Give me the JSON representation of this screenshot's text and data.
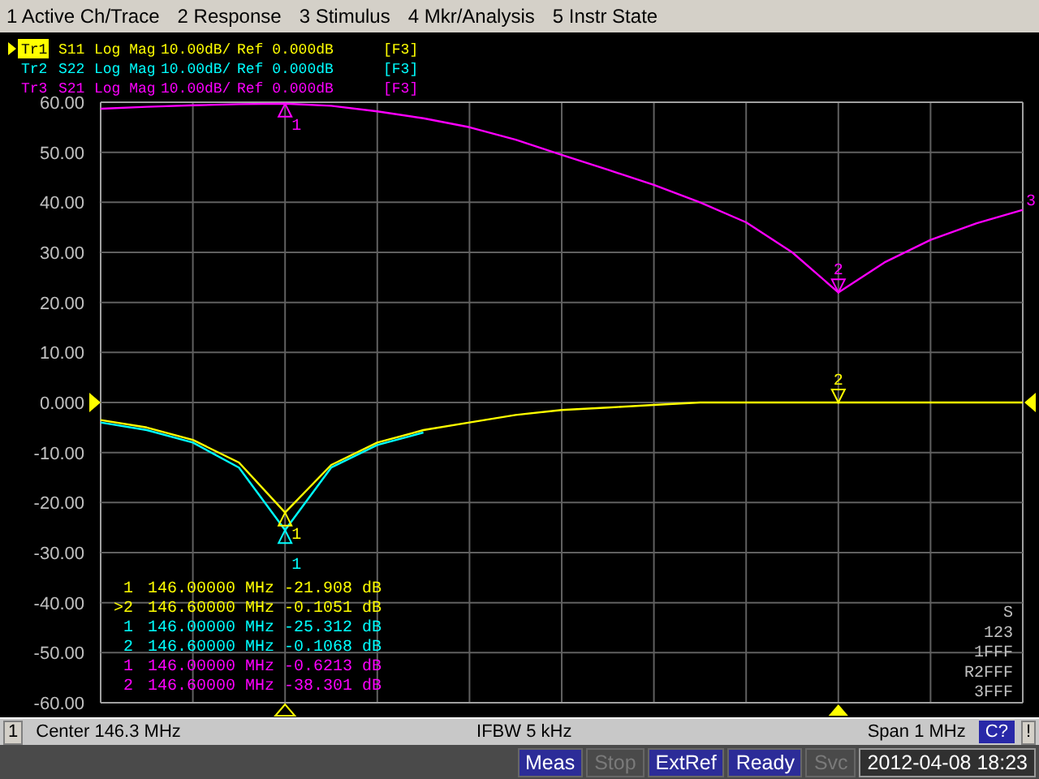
{
  "menu": [
    "1 Active Ch/Trace",
    "2 Response",
    "3 Stimulus",
    "4 Mkr/Analysis",
    "5 Instr State"
  ],
  "traces": [
    {
      "name": "Tr1",
      "parameter": "S11",
      "format": "Log Mag",
      "scale": "10.00dB/",
      "reference": "Ref 0.000dB",
      "tag": "[F3]",
      "selected": true,
      "markers": [
        "1",
        "2"
      ]
    },
    {
      "name": "Tr2",
      "parameter": "S22",
      "format": "Log Mag",
      "scale": "10.00dB/",
      "reference": "Ref 0.000dB",
      "tag": "[F3]",
      "selected": false,
      "markers": [
        "1"
      ]
    },
    {
      "name": "Tr3",
      "parameter": "S21",
      "format": "Log Mag",
      "scale": "10.00dB/",
      "reference": "Ref 0.000dB",
      "tag": "[F3]",
      "selected": false,
      "markers": [
        "1",
        "2"
      ],
      "end_label": "3"
    }
  ],
  "chart_data": {
    "type": "line",
    "grid": true,
    "ylim": [
      -60,
      60
    ],
    "yticks": [
      {
        "value": 60,
        "label": "60.00"
      },
      {
        "value": 50,
        "label": "50.00"
      },
      {
        "value": 40,
        "label": "40.00"
      },
      {
        "value": 30,
        "label": "30.00"
      },
      {
        "value": 20,
        "label": "20.00"
      },
      {
        "value": 10,
        "label": "10.00"
      },
      {
        "value": 0,
        "label": "0.000"
      },
      {
        "value": -10,
        "label": "-10.00"
      },
      {
        "value": -20,
        "label": "-20.00"
      },
      {
        "value": -30,
        "label": "-30.00"
      },
      {
        "value": -40,
        "label": "-40.00"
      },
      {
        "value": -50,
        "label": "-50.00"
      },
      {
        "value": -60,
        "label": "-60.00"
      }
    ],
    "categories": [
      null,
      null,
      null,
      null,
      null,
      null,
      null,
      null,
      null,
      null,
      null,
      null,
      null,
      null,
      null,
      null,
      null,
      null,
      null,
      null,
      null
    ],
    "series": [
      {
        "color": "#ffff00",
        "values": [
          -3.5,
          -5,
          -7.5,
          -12,
          -22,
          -12.5,
          -8,
          -5.5,
          -4,
          -2.5,
          -1.5,
          -1,
          -0.5,
          0,
          0,
          0,
          0,
          0,
          0,
          0,
          0
        ]
      },
      {
        "color": "#00ffff",
        "values": [
          -4,
          -5.5,
          -8,
          -13,
          -25.5,
          -13,
          -8.5,
          -6,
          null,
          null,
          null,
          null,
          null,
          null,
          null,
          null,
          null,
          null,
          null,
          null,
          null
        ]
      },
      {
        "color": "#ff00ff",
        "values": [
          58.7,
          59.1,
          59.4,
          59.6,
          59.7,
          59.3,
          58.2,
          56.8,
          55,
          52.5,
          49.5,
          46.5,
          43.5,
          40,
          36,
          30,
          22,
          28,
          32.5,
          35.8,
          38.5
        ]
      }
    ]
  },
  "marker_table": [
    {
      "marker": "1",
      "frequency": "146.00000 MHz",
      "value": "-21.908 dB",
      "color": "#ffff00"
    },
    {
      "marker": ">2",
      "frequency": "146.60000 MHz",
      "value": "-0.1051 dB",
      "color": "#ffff00"
    },
    {
      "marker": "1",
      "frequency": "146.00000 MHz",
      "value": "-25.312 dB",
      "color": "#00ffff"
    },
    {
      "marker": "2",
      "frequency": "146.60000 MHz",
      "value": "-0.1068 dB",
      "color": "#00ffff"
    },
    {
      "marker": "1",
      "frequency": "146.00000 MHz",
      "value": "-0.6213 dB",
      "color": "#ff00ff"
    },
    {
      "marker": "2",
      "frequency": "146.60000 MHz",
      "value": "-38.301 dB",
      "color": "#ff00ff"
    }
  ],
  "trace_status": [
    "S",
    "123",
    "1FFF",
    "R2FFF",
    "3FFF"
  ],
  "channel_bar": {
    "channel": "1",
    "center": "Center 146.3 MHz",
    "ifbw": "IFBW 5 kHz",
    "span": "Span 1 MHz",
    "calibration": "C?",
    "alert": "!"
  },
  "status_bar": [
    {
      "label": "Meas",
      "disabled": false
    },
    {
      "label": "Stop",
      "disabled": true
    },
    {
      "label": "ExtRef",
      "disabled": false
    },
    {
      "label": "Ready",
      "disabled": false
    },
    {
      "label": "Svc",
      "disabled": true
    }
  ],
  "datetime": "2012-04-08 18:23"
}
